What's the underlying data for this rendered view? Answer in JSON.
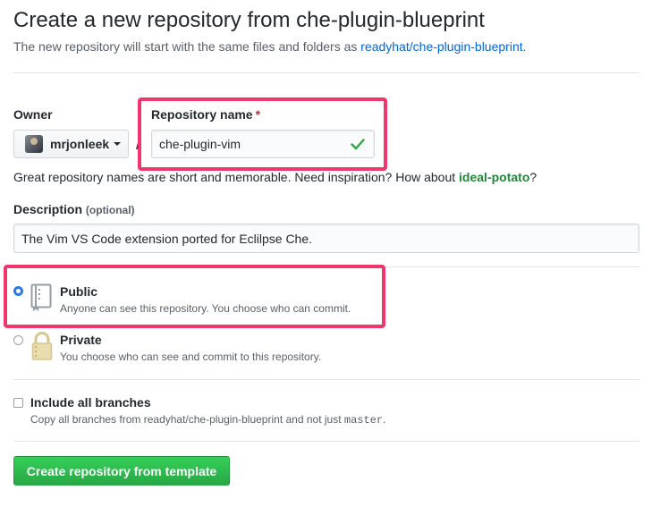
{
  "header": {
    "title": "Create a new repository from che-plugin-blueprint",
    "subtitle_prefix": "The new repository will start with the same files and folders as ",
    "template_link": "readyhat/che-plugin-blueprint",
    "subtitle_suffix": "."
  },
  "owner": {
    "label": "Owner",
    "value": "mrjonleek"
  },
  "slash": "/",
  "repository_name": {
    "label": "Repository name",
    "required_mark": "*",
    "value": "che-plugin-vim",
    "valid_icon": "check-icon"
  },
  "name_hint": {
    "text": "Great repository names are short and memorable. Need inspiration? How about ",
    "suggestion": "ideal-potato",
    "suffix": "?"
  },
  "description": {
    "label": "Description",
    "optional": "(optional)",
    "value": "The Vim VS Code extension ported for Eclilpse Che."
  },
  "visibility": {
    "public": {
      "title": "Public",
      "desc": "Anyone can see this repository. You choose who can commit.",
      "selected": true,
      "icon": "repo-icon"
    },
    "private": {
      "title": "Private",
      "desc": "You choose who can see and commit to this repository.",
      "selected": false,
      "icon": "lock-icon"
    }
  },
  "branches": {
    "title": "Include all branches",
    "desc_prefix": "Copy all branches from readyhat/che-plugin-blueprint and not just ",
    "desc_code": "master",
    "desc_suffix": ".",
    "checked": false
  },
  "submit": {
    "label": "Create repository from template"
  },
  "colors": {
    "highlight": "#f0366d",
    "link": "#0366d6",
    "button_green": "#2ea44f",
    "suggestion_green": "#22863a"
  }
}
